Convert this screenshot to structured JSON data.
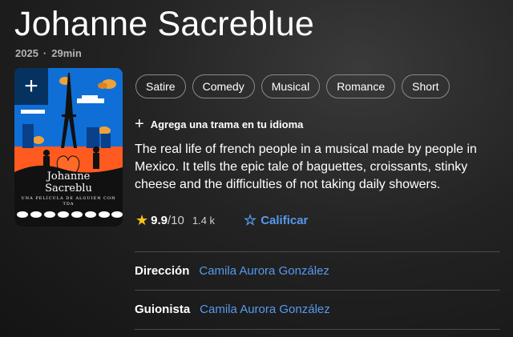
{
  "title": "Johanne Sacreblue",
  "meta": {
    "year": "2025",
    "separator": "·",
    "duration": "29min"
  },
  "poster": {
    "add_label": "+",
    "title_line1": "Johanne",
    "title_line2": "Sacreblu",
    "subtitle_line1": "UNA PELÍCULA DE ALGUIEN CON",
    "subtitle_line2": "TDA"
  },
  "genres": [
    "Satire",
    "Comedy",
    "Musical",
    "Romance",
    "Short"
  ],
  "add_plot": {
    "icon": "+",
    "label": "Agrega una trama en tu idioma"
  },
  "plot": "The real life of french people in a musical made by people in Mexico. It tells the epic tale of baguettes, croissants, stinky cheese and the difficulties of not taking daily showers.",
  "rating": {
    "icon": "★",
    "score": "9.9",
    "out_of": "/10",
    "votes": "1.4 k",
    "rate_icon": "☆",
    "rate_label": "Calificar"
  },
  "credits": [
    {
      "label": "Dirección",
      "value": "Camila Aurora González"
    },
    {
      "label": "Guionista",
      "value": "Camila Aurora González"
    }
  ],
  "colors": {
    "accent": "#5799ef",
    "star": "#f5c518",
    "poster_sky": "#0f6fd6",
    "poster_ground": "#ff5a1f"
  }
}
